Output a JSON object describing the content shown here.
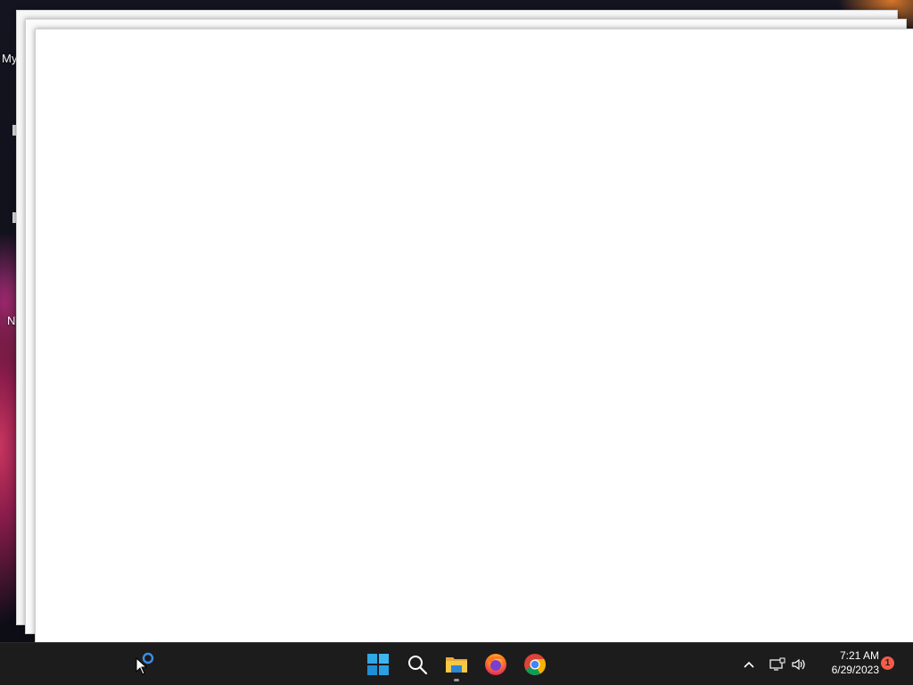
{
  "desktop": {
    "labels": {
      "top": "My",
      "middle": "N"
    }
  },
  "taskbar": {
    "apps": [
      {
        "name": "Start",
        "icon": "windows-start-icon"
      },
      {
        "name": "Search",
        "icon": "search-icon"
      },
      {
        "name": "File Explorer",
        "icon": "file-explorer-icon",
        "running": true
      },
      {
        "name": "Firefox",
        "icon": "firefox-icon"
      },
      {
        "name": "Chrome",
        "icon": "chrome-icon"
      }
    ],
    "tray": {
      "time": "7:21 AM",
      "date": "6/29/2023",
      "notification_count": "1"
    }
  },
  "colors": {
    "taskbar_bg": "#1c1c1c",
    "start_blue": "#2ea7e8",
    "notification_badge": "#f25c4a"
  }
}
